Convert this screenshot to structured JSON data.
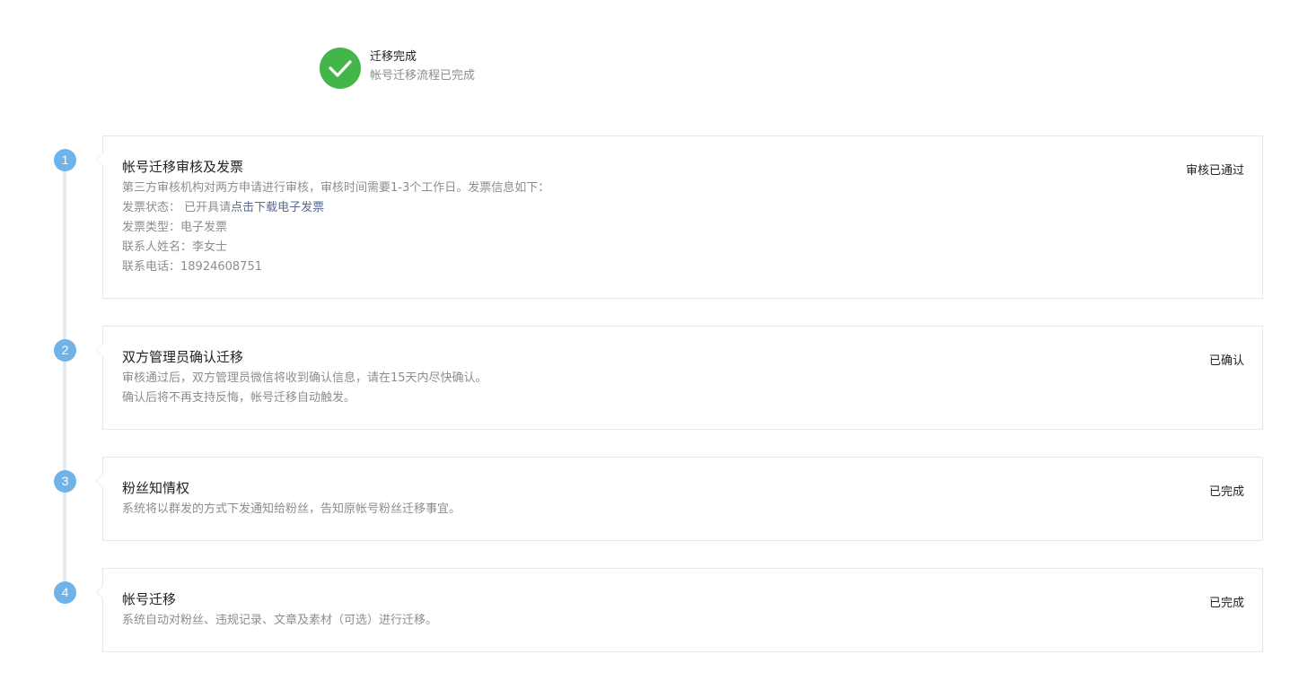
{
  "header": {
    "title": "迁移完成",
    "description": "帐号迁移流程已完成",
    "icon": "check-icon",
    "icon_color": "#44b549"
  },
  "steps": [
    {
      "number": "1",
      "title": "帐号迁移审核及发票",
      "status": "审核已通过",
      "lines": [
        "第三方审核机构对两方申请进行审核，审核时间需要1-3个工作日。发票信息如下：",
        "发票状态： 已开具请"
      ],
      "invoice_link": "点击下载电子发票",
      "invoice_type": "发票类型：电子发票",
      "contact_name": "联系人姓名：李女士",
      "contact_phone": "联系电话：18924608751"
    },
    {
      "number": "2",
      "title": "双方管理员确认迁移",
      "status": "已确认",
      "lines": [
        "审核通过后，双方管理员微信将收到确认信息，请在15天内尽快确认。",
        "确认后将不再支持反悔，帐号迁移自动触发。"
      ]
    },
    {
      "number": "3",
      "title": "粉丝知情权",
      "status": "已完成",
      "lines": [
        "系统将以群发的方式下发通知给粉丝，告知原帐号粉丝迁移事宜。"
      ]
    },
    {
      "number": "4",
      "title": "帐号迁移",
      "status": "已完成",
      "lines": [
        "系统自动对粉丝、违规记录、文章及素材（可选）进行迁移。"
      ]
    }
  ],
  "colors": {
    "step_number_bg": "#6fb3e8",
    "link": "#576b95",
    "timeline": "#e7e8eb",
    "card_border": "#e7e7eb"
  }
}
